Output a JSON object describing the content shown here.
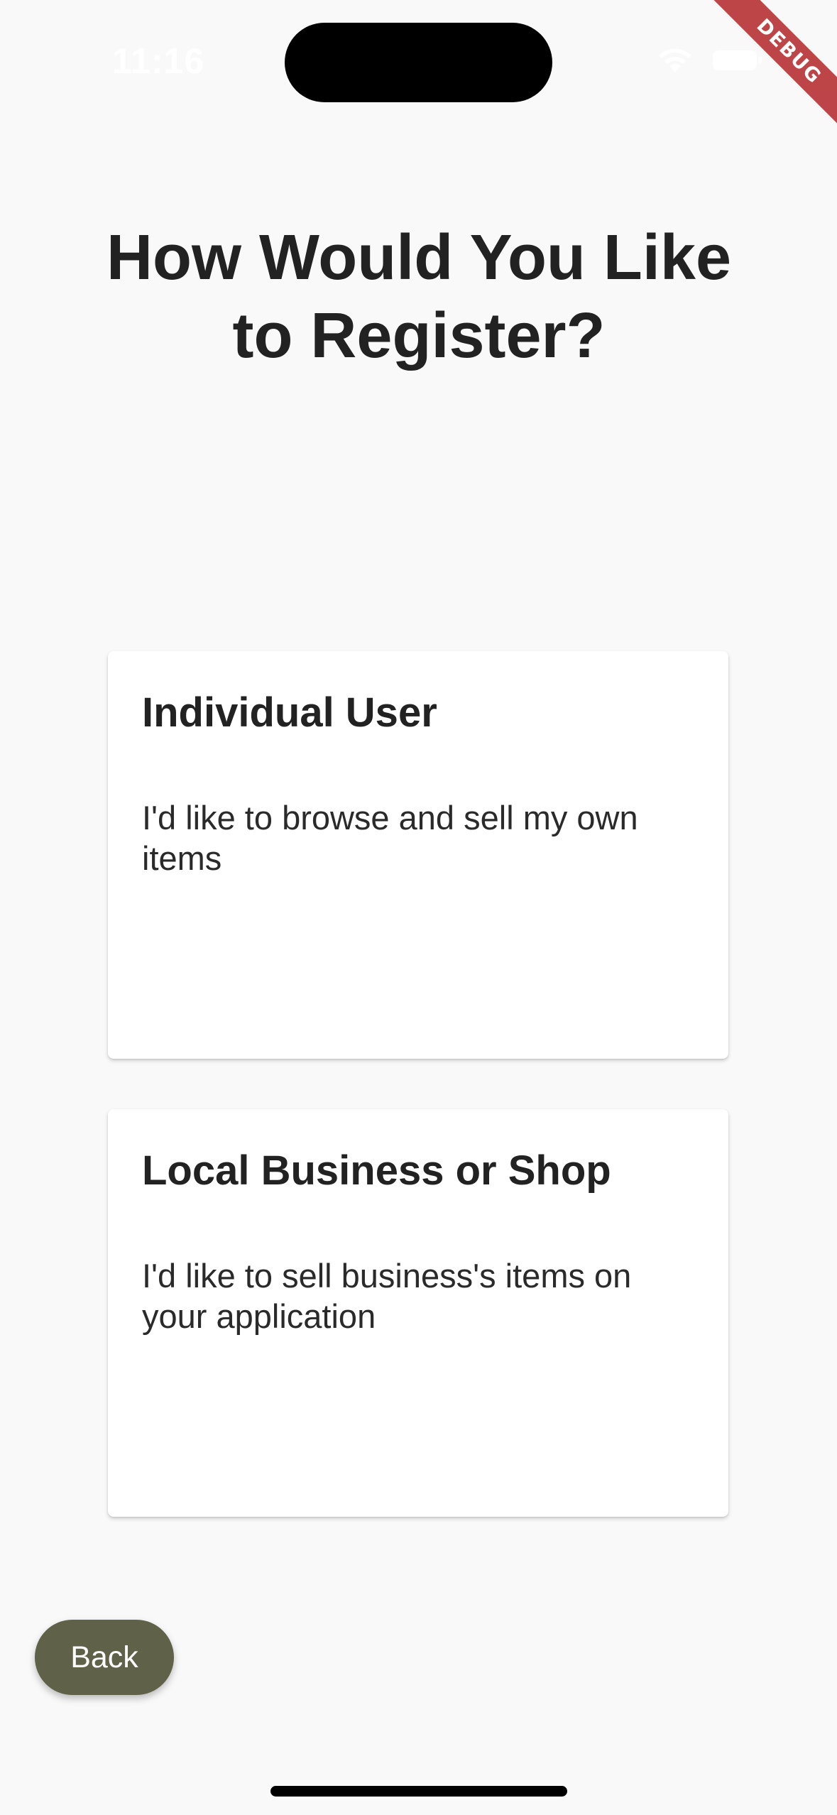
{
  "status_bar": {
    "time": "11:16",
    "icons": [
      "wifi-icon",
      "battery-icon"
    ]
  },
  "debug_banner": {
    "label": "DEBUG",
    "color": "#b3262a"
  },
  "page": {
    "title": "How Would You Like to Register?"
  },
  "options": [
    {
      "title": "Individual User",
      "description": "I'd like to browse and sell my own items"
    },
    {
      "title": "Local Business or Shop",
      "description": "I'd like to sell business's items on your application"
    }
  ],
  "back_button": {
    "label": "Back",
    "color": "#5f6149"
  }
}
